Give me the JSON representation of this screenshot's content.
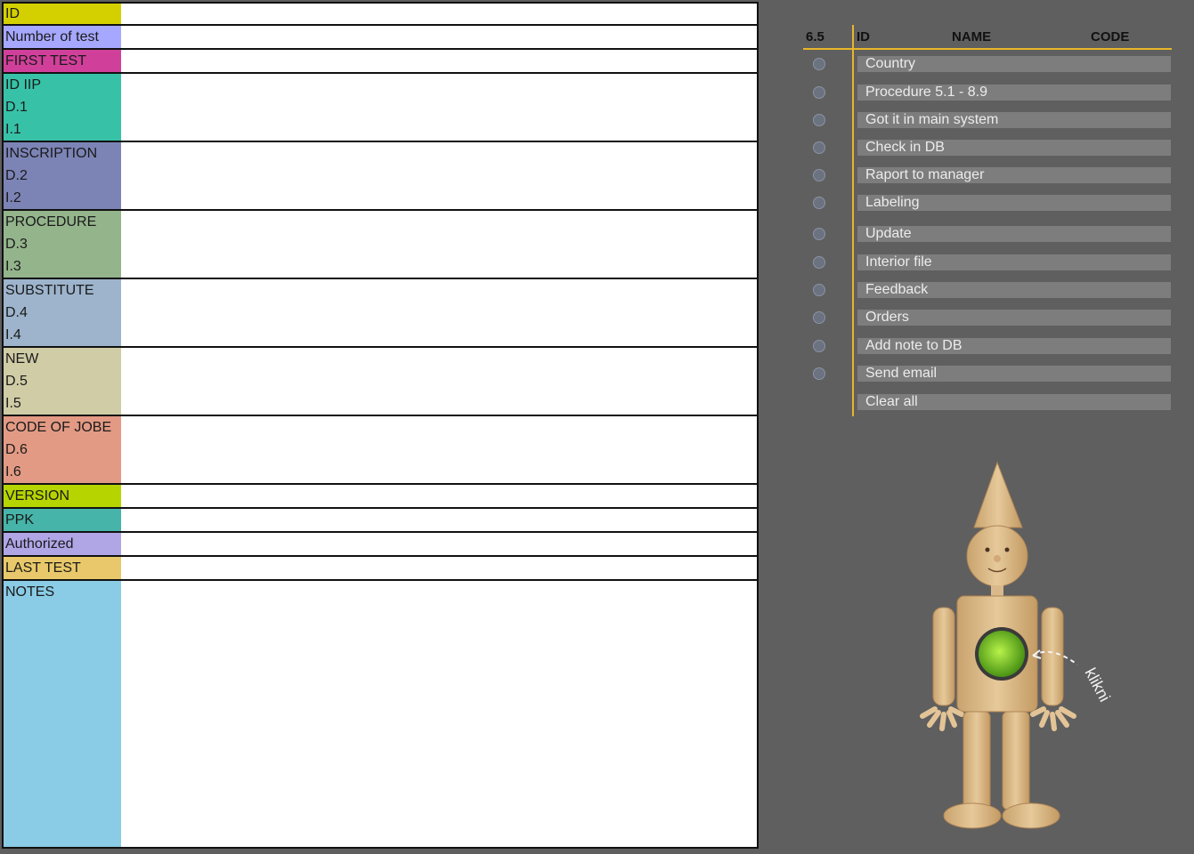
{
  "form": {
    "rows": [
      {
        "lines": [
          "ID"
        ],
        "color": "#d4d000"
      },
      {
        "lines": [
          "Number of test"
        ],
        "color": "#a6a8ff"
      },
      {
        "lines": [
          "FIRST TEST"
        ],
        "color": "#d0409a"
      },
      {
        "lines": [
          "ID IIP",
          "D.1",
          "I.1"
        ],
        "color": "#37c2a8"
      },
      {
        "lines": [
          "INSCRIPTION",
          "D.2",
          "I.2"
        ],
        "color": "#7c84b6"
      },
      {
        "lines": [
          "PROCEDURE",
          "D.3",
          "I.3"
        ],
        "color": "#94b48c"
      },
      {
        "lines": [
          "SUBSTITUTE",
          "D.4",
          "I.4"
        ],
        "color": "#9db4cc"
      },
      {
        "lines": [
          "NEW",
          "D.5",
          "I.5"
        ],
        "color": "#cfcca6"
      },
      {
        "lines": [
          "CODE OF JOBE",
          "D.6",
          "I.6"
        ],
        "color": "#e39a84"
      },
      {
        "lines": [
          "VERSION"
        ],
        "color": "#b6d400"
      },
      {
        "lines": [
          "PPK"
        ],
        "color": "#46b4a8"
      },
      {
        "lines": [
          "Authorized"
        ],
        "color": "#b0a6e6"
      },
      {
        "lines": [
          "LAST TEST"
        ],
        "color": "#e8c86a"
      },
      {
        "lines": [
          "NOTES"
        ],
        "color": "#8acbe5"
      }
    ]
  },
  "list": {
    "headers": {
      "col1": "6.5",
      "col2": "ID",
      "col3": "NAME",
      "col4": "CODE"
    },
    "items": [
      {
        "label": "Country",
        "radio": true
      },
      {
        "label": "Procedure 5.1 - 8.9",
        "radio": true
      },
      {
        "label": "Got it in main system",
        "radio": true
      },
      {
        "label": "Check in DB",
        "radio": true
      },
      {
        "label": "Raport to manager",
        "radio": true
      },
      {
        "label": "Labeling",
        "radio": true
      },
      {
        "label": "Update",
        "radio": true
      },
      {
        "label": "Interior file",
        "radio": true
      },
      {
        "label": "Feedback",
        "radio": true
      },
      {
        "label": "Orders",
        "radio": true
      },
      {
        "label": "Add note to DB",
        "radio": true
      },
      {
        "label": "Send email",
        "radio": true
      },
      {
        "label": "Clear all",
        "radio": false
      }
    ]
  },
  "mascot": {
    "label": "klikni"
  }
}
